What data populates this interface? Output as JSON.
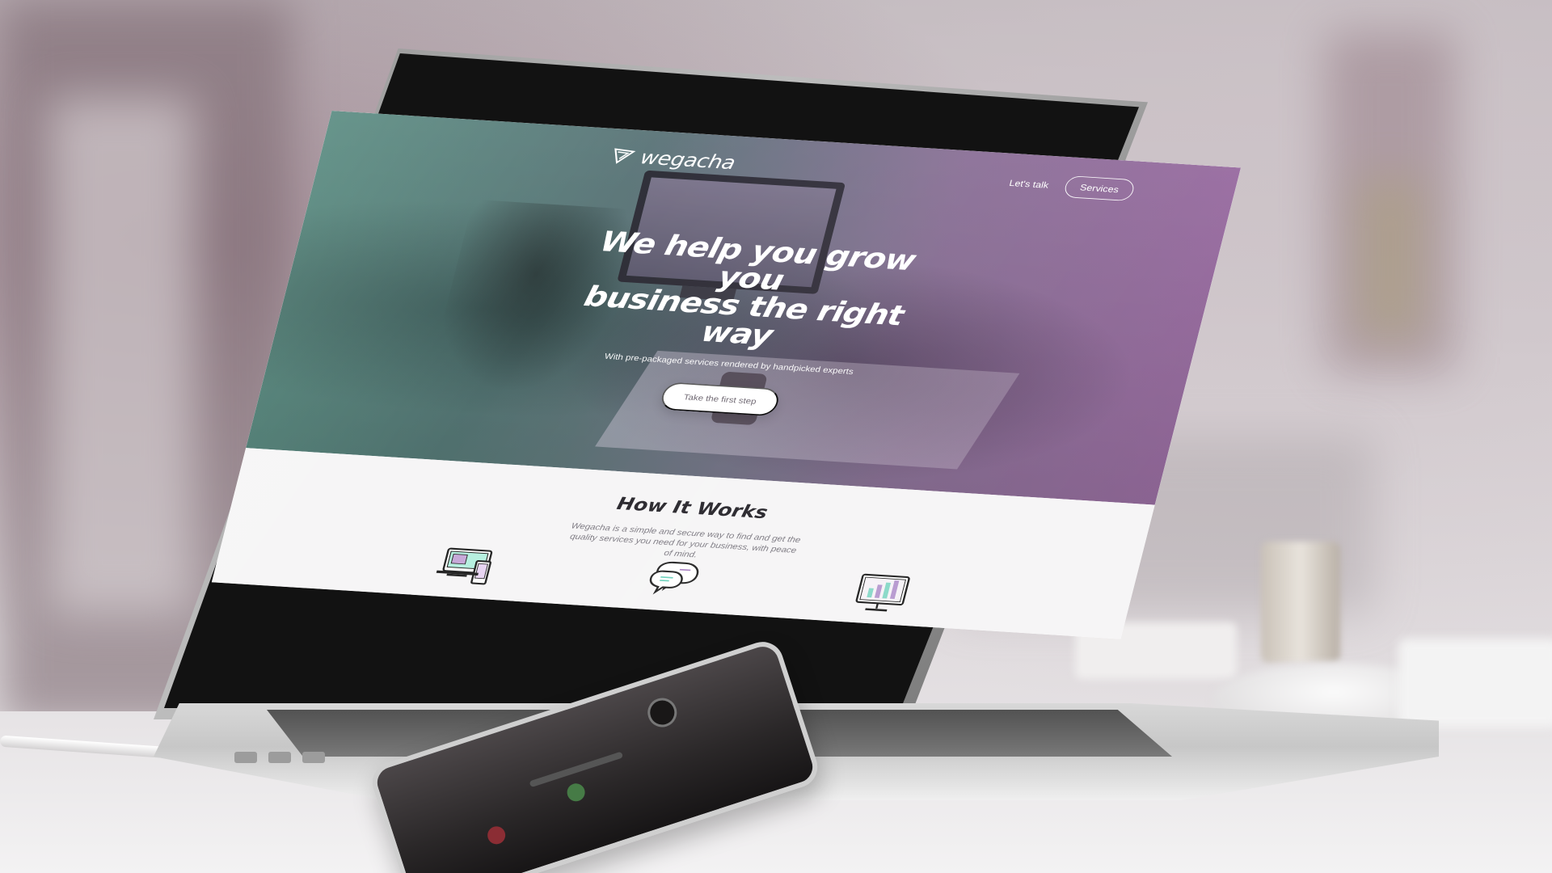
{
  "site": {
    "brand": "wegacha",
    "nav": {
      "lets_talk": "Let's talk",
      "services": "Services"
    },
    "hero": {
      "headline_line1": "We help you grow you",
      "headline_line2": "business the right way",
      "subtitle": "With pre-packaged services rendered by handpicked experts",
      "cta": "Take the first step"
    },
    "how_it_works": {
      "title": "How It Works",
      "description": "Wegacha is a simple and secure way to find and get the quality services you need for your business, with peace of mind."
    }
  },
  "icons": {
    "logo": "triangle-logo-icon",
    "feature1": "devices-icon",
    "feature2": "chat-bubbles-icon",
    "feature3": "analytics-screen-icon"
  },
  "colors": {
    "teal": "#458477",
    "purple": "#9961a3",
    "text_dark": "#252329",
    "text_muted": "#7b7880"
  }
}
